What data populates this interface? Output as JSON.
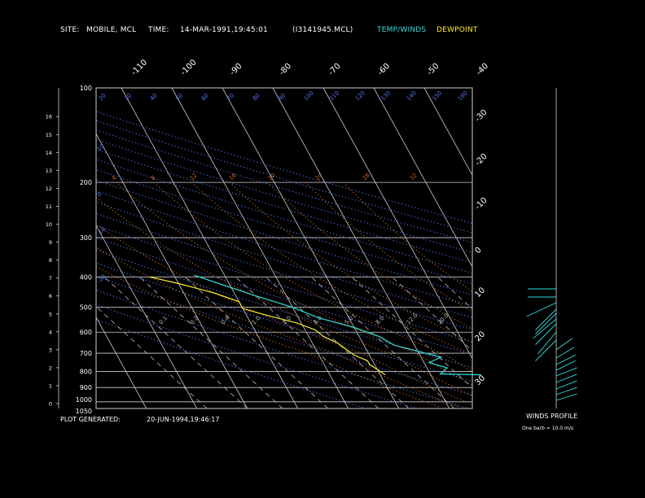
{
  "header": {
    "site_label": "SITE:",
    "site_value": "MOBILE, MCL",
    "time_label": "TIME:",
    "time_value": "14-MAR-1991,19:45:01",
    "file_value": "(I3141945.MCL)",
    "temp_winds_label": "TEMP/WINDS",
    "dewpoint_label": "DEWPOINT"
  },
  "footer": {
    "plot_generated_label": "PLOT GENERATED:",
    "plot_generated_value": "20-JUN-1994,19:46:17",
    "winds_profile_label": "WINDS PROFILE",
    "barb_note": "One barb = 10.0 m/s"
  },
  "colors": {
    "background": "#000000",
    "temperature": "#33dddd",
    "dewpoint": "#ffee33",
    "grid": "#cfcfcf",
    "dry_adiabat": "#5577ee",
    "moist_adiabat": "#cc6622",
    "mixing_ratio": "#bbbbbb",
    "text": "#ffffff"
  },
  "chart_data": {
    "type": "line",
    "y_scale": "log-pressure",
    "pressure_ticks": [
      100,
      200,
      300,
      400,
      500,
      600,
      700,
      800,
      900,
      1000,
      1050
    ],
    "height_ticks_km": [
      0,
      1,
      2,
      3,
      4,
      5,
      6,
      7,
      8,
      9,
      10,
      11,
      12,
      13,
      14,
      15,
      16
    ],
    "isotherm_labels_top": [
      "-110",
      "-100",
      "-90",
      "-80",
      "-70",
      "-60",
      "-50",
      "-40"
    ],
    "isotherm_labels_right": [
      "-30",
      "-20",
      "-10",
      "0",
      "10",
      "20",
      "30"
    ],
    "dry_adiabat_labels": [
      "-20",
      "-10",
      "0",
      "10",
      "20",
      "30",
      "40",
      "50",
      "60",
      "70",
      "80",
      "90",
      "100",
      "110",
      "120",
      "130",
      "140",
      "150",
      "160"
    ],
    "moist_adiabat_labels": [
      "4",
      "8",
      "12",
      "16",
      "20",
      "24",
      "28",
      "32"
    ],
    "mixing_ratio_labels": [
      "0.1",
      "0.2",
      "0.4",
      "1.0",
      "2.0",
      "3.0",
      "5.0",
      "8.0",
      "12.0",
      "20.0"
    ],
    "temperature_profile": [
      {
        "p": 820,
        "t": 10
      },
      {
        "p": 815,
        "t": 2
      },
      {
        "p": 780,
        "t": 4
      },
      {
        "p": 750,
        "t": 1
      },
      {
        "p": 720,
        "t": 4
      },
      {
        "p": 690,
        "t": 0
      },
      {
        "p": 660,
        "t": -4
      },
      {
        "p": 620,
        "t": -6
      },
      {
        "p": 580,
        "t": -10
      },
      {
        "p": 540,
        "t": -16
      },
      {
        "p": 500,
        "t": -20
      },
      {
        "p": 460,
        "t": -26
      },
      {
        "p": 420,
        "t": -32
      },
      {
        "p": 395,
        "t": -36
      }
    ],
    "dewpoint_profile": [
      {
        "p": 820,
        "t": -9
      },
      {
        "p": 790,
        "t": -10
      },
      {
        "p": 760,
        "t": -11
      },
      {
        "p": 740,
        "t": -11
      },
      {
        "p": 710,
        "t": -13
      },
      {
        "p": 680,
        "t": -14
      },
      {
        "p": 650,
        "t": -15
      },
      {
        "p": 620,
        "t": -17
      },
      {
        "p": 590,
        "t": -18
      },
      {
        "p": 560,
        "t": -21
      },
      {
        "p": 530,
        "t": -26
      },
      {
        "p": 505,
        "t": -30
      },
      {
        "p": 480,
        "t": -30
      },
      {
        "p": 450,
        "t": -34
      },
      {
        "p": 420,
        "t": -40
      },
      {
        "p": 400,
        "t": -45
      }
    ]
  }
}
